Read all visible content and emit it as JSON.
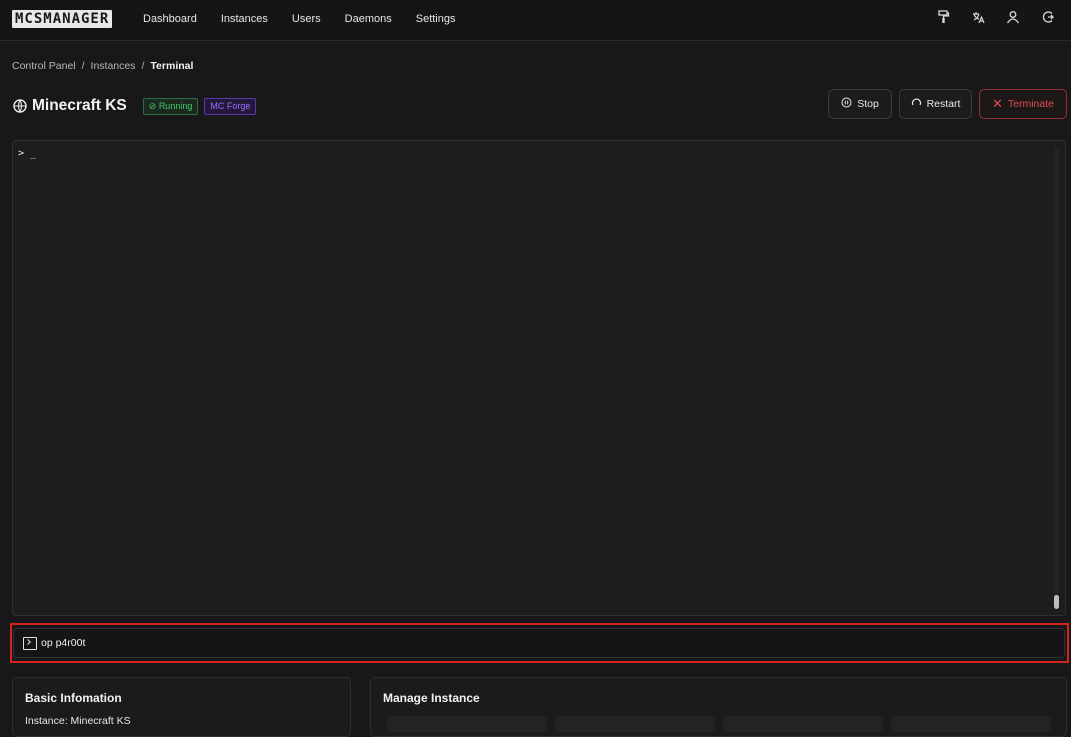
{
  "app": {
    "logo": "MCSMANAGER"
  },
  "nav": {
    "items": [
      "Dashboard",
      "Instances",
      "Users",
      "Daemons",
      "Settings"
    ],
    "icons": [
      "paint-brush-icon",
      "language-icon",
      "user-icon",
      "logout-icon"
    ]
  },
  "breadcrumb": {
    "items": [
      "Control Panel",
      "Instances"
    ],
    "current": "Terminal",
    "separator": "/"
  },
  "instance": {
    "title": "Minecraft KS",
    "status_badge": "Running",
    "type_badge": "MC Forge"
  },
  "actions": {
    "stop": "Stop",
    "restart": "Restart",
    "terminate": "Terminate"
  },
  "terminal": {
    "prompt": "> _",
    "scroll_position": 1.0
  },
  "command": {
    "value": "op p4r00t"
  },
  "basic_info": {
    "title": "Basic Infomation",
    "instance_line": "Instance: Minecraft KS"
  },
  "manage": {
    "title": "Manage Instance"
  },
  "colors": {
    "accent_danger": "#d2231c",
    "running": "#49c46a",
    "forge": "#9d6dff"
  }
}
